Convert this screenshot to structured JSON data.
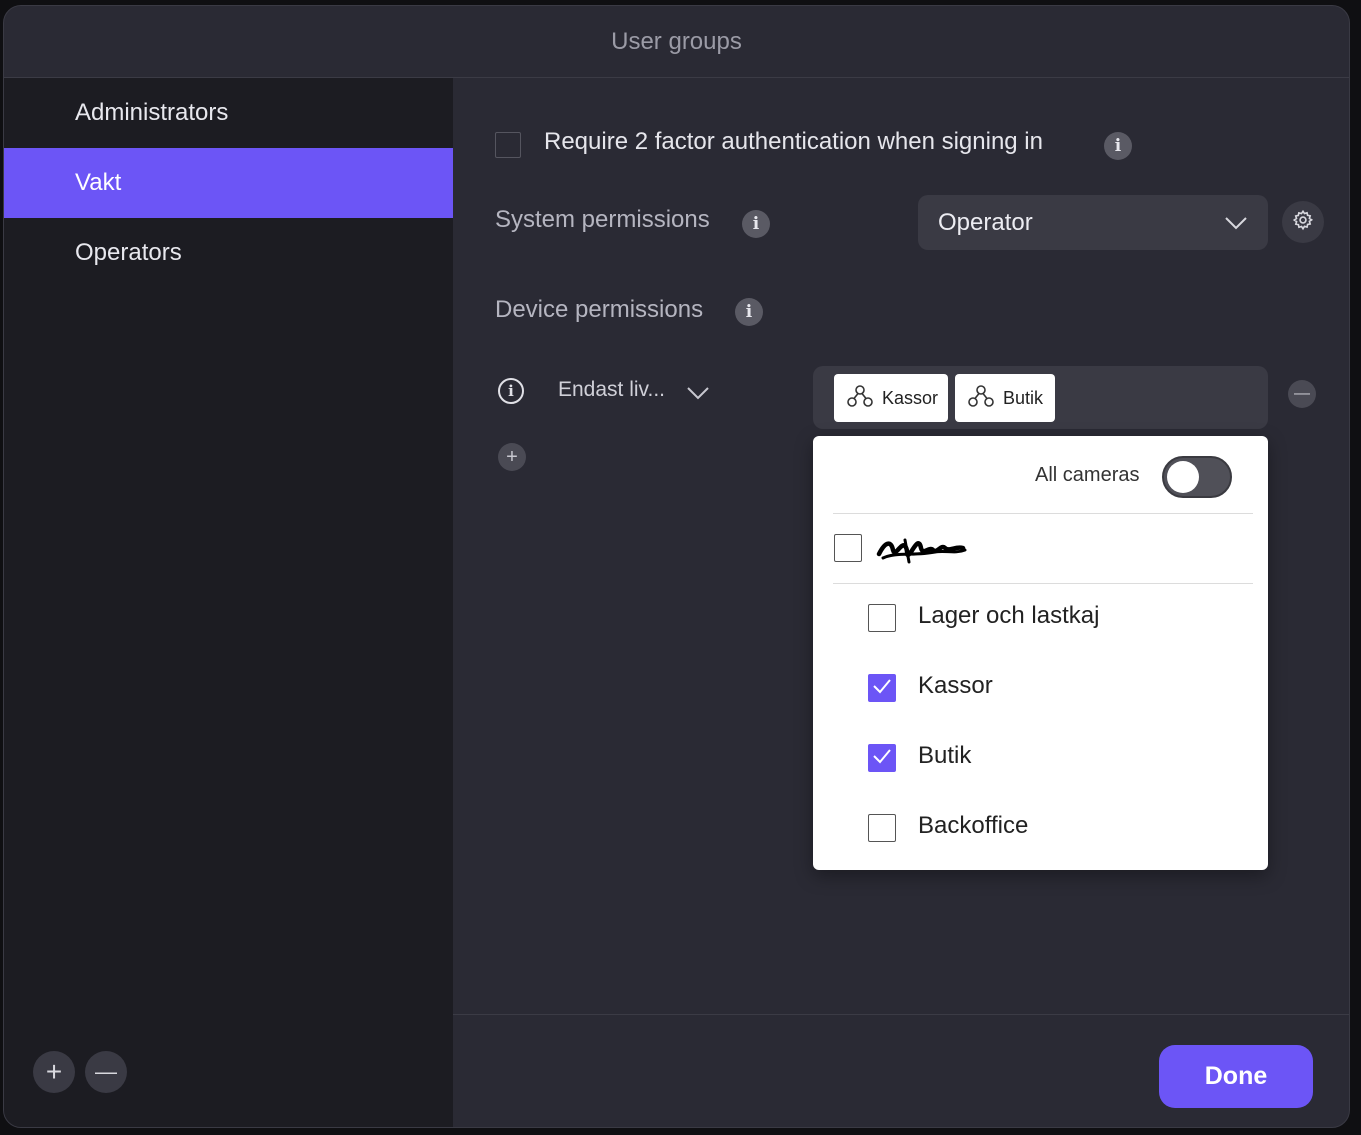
{
  "dialog": {
    "title": "User groups"
  },
  "sidebar": {
    "groups": [
      {
        "label": "Administrators",
        "selected": false
      },
      {
        "label": "Vakt",
        "selected": true
      },
      {
        "label": "Operators",
        "selected": false
      }
    ],
    "add_label": "+",
    "remove_label": "—"
  },
  "main": {
    "two_factor": {
      "label": "Require 2 factor authentication when signing in",
      "checked": false
    },
    "info_glyph": "i",
    "system_permissions": {
      "label": "System permissions",
      "value": "Operator"
    },
    "device_permissions": {
      "label": "Device permissions",
      "row": {
        "role": "Endast liv...",
        "chips": [
          "Kassor",
          "Butik"
        ],
        "remove_label": "—"
      },
      "add_label": "+"
    }
  },
  "dropdown": {
    "all_cameras_label": "All cameras",
    "all_cameras_on": false,
    "root_checked": false,
    "items": [
      {
        "label": "Lager och lastkaj",
        "checked": false
      },
      {
        "label": "Kassor",
        "checked": true
      },
      {
        "label": "Butik",
        "checked": true
      },
      {
        "label": "Backoffice",
        "checked": false
      }
    ]
  },
  "footer": {
    "done_label": "Done"
  },
  "colors": {
    "accent": "#6c55f6",
    "panel": "#2a2a34",
    "sidebar": "#1c1c22"
  }
}
